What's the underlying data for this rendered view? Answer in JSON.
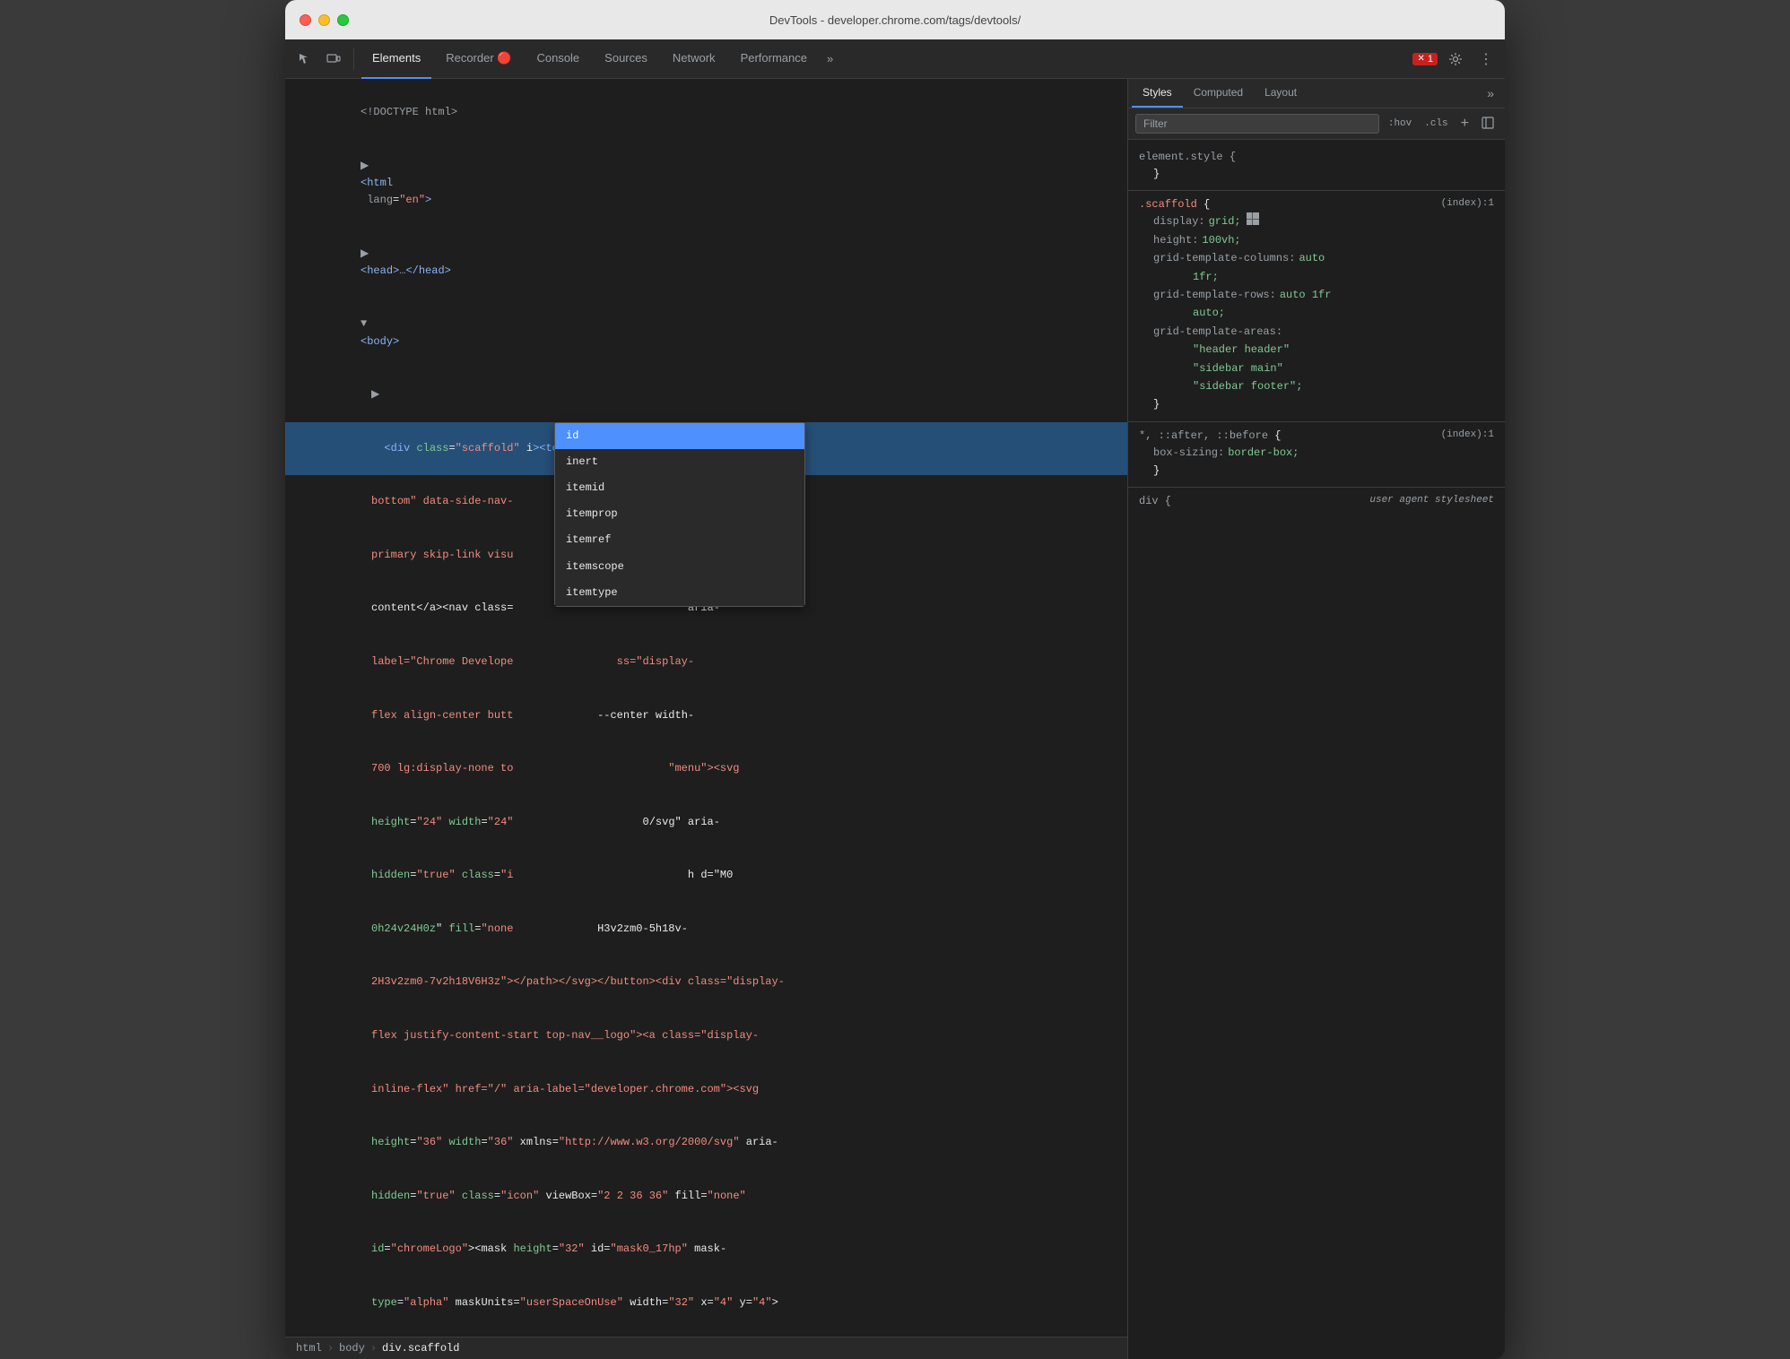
{
  "titlebar": {
    "title": "DevTools - developer.chrome.com/tags/devtools/"
  },
  "toolbar": {
    "tabs": [
      {
        "label": "Elements",
        "active": true
      },
      {
        "label": "Recorder 🔴",
        "active": false
      },
      {
        "label": "Console",
        "active": false
      },
      {
        "label": "Sources",
        "active": false
      },
      {
        "label": "Network",
        "active": false
      },
      {
        "label": "Performance",
        "active": false
      }
    ],
    "more_label": "»",
    "error_count": "1",
    "error_icon": "✕"
  },
  "elements_panel": {
    "lines": [
      {
        "text": "<!DOCTYPE html>",
        "indent": 0,
        "type": "comment"
      },
      {
        "text": "<html lang=\"en\">",
        "indent": 0,
        "type": "tag"
      },
      {
        "text": "▶ <head>…</head>",
        "indent": 1,
        "type": "collapsed"
      },
      {
        "text": "▼ <body>",
        "indent": 1,
        "type": "tag"
      },
      {
        "text": "▶",
        "indent": 2,
        "type": "triangle"
      }
    ],
    "selected_content_part1": "<div class=\"scaffold\" i",
    "selected_content_part2": "><top-nav class=\"display-block hairline-",
    "autocomplete_items": [
      {
        "label": "id",
        "highlighted": true
      },
      {
        "label": "inert",
        "highlighted": false
      },
      {
        "label": "itemid",
        "highlighted": false
      },
      {
        "label": "itemprop",
        "highlighted": false
      },
      {
        "label": "itemref",
        "highlighted": false
      },
      {
        "label": "itemscope",
        "highlighted": false
      },
      {
        "label": "itemtype",
        "highlighted": false
      }
    ],
    "content_lines": [
      "bottom\" data-side-nav-                       ss=\"color-",
      "primary skip-link visu                ent\">Skip to",
      "content</a><nav class=                           aria-",
      "label=\"Chrome Develope                ss=\"display-",
      "flex align-center butt             -center width-",
      "700 lg:display-none to                        \"menu\"><svg",
      "height=\"24\" width=\"24\"                      0/svg\" aria-",
      "hidden=\"true\" class=\"i                           h d=\"M0",
      "0h24v24H0z\" fill=\"none             H3v2zm0-5h18v-",
      "2H3v2zm0-7v2h18V6H3z\"></path></svg></button><div class=\"display-",
      "flex justify-content-start top-nav__logo\"><a class=\"display-",
      "inline-flex\" href=\"/\" aria-label=\"developer.chrome.com\"><svg",
      "height=\"36\" width=\"36\" xmlns=\"http://www.w3.org/2000/svg\" aria-",
      "hidden=\"true\" class=\"icon\" viewBox=\"2 2 36 36\" fill=\"none\"",
      "id=\"chromeLogo\"><mask height=\"32\" id=\"mask0_17hp\" mask-",
      "type=\"alpha\" maskUnits=\"userSpaceOnUse\" width=\"32\" x=\"4\" y=\"4\">"
    ]
  },
  "breadcrumb": {
    "items": [
      "html",
      "body",
      "div.scaffold"
    ]
  },
  "styles_panel": {
    "tabs": [
      {
        "label": "Styles",
        "active": true
      },
      {
        "label": "Computed",
        "active": false
      },
      {
        "label": "Layout",
        "active": false
      }
    ],
    "filter_placeholder": "Filter",
    "pseudo_hover": ":hov",
    "pseudo_cls": ".cls",
    "rules": [
      {
        "selector": "element.style",
        "source": "",
        "brace_open": "{",
        "brace_close": "}",
        "properties": []
      },
      {
        "selector": ".scaffold",
        "source": "(index):1",
        "brace_open": "{",
        "brace_close": "}",
        "properties": [
          {
            "prop": "display:",
            "value": "grid;",
            "extra": "grid-icon"
          },
          {
            "prop": "height:",
            "value": "100vh;"
          },
          {
            "prop": "grid-template-columns:",
            "value": "auto"
          },
          {
            "prop": "",
            "value": "1fr;"
          },
          {
            "prop": "grid-template-rows:",
            "value": "auto 1fr"
          },
          {
            "prop": "",
            "value": "auto;"
          },
          {
            "prop": "grid-template-areas:",
            "value": ""
          },
          {
            "prop": "",
            "value": "\"header header\""
          },
          {
            "prop": "",
            "value": "\"sidebar main\""
          },
          {
            "prop": "",
            "value": "\"sidebar footer\";"
          }
        ]
      },
      {
        "selector": "*, ::after, ::before",
        "source": "(index):1",
        "brace_open": "{",
        "brace_close": "}",
        "properties": [
          {
            "prop": "box-sizing:",
            "value": "border-box;"
          }
        ]
      },
      {
        "selector": "div",
        "source": "user agent stylesheet",
        "brace_open": "{",
        "brace_close": "",
        "properties": []
      }
    ]
  }
}
